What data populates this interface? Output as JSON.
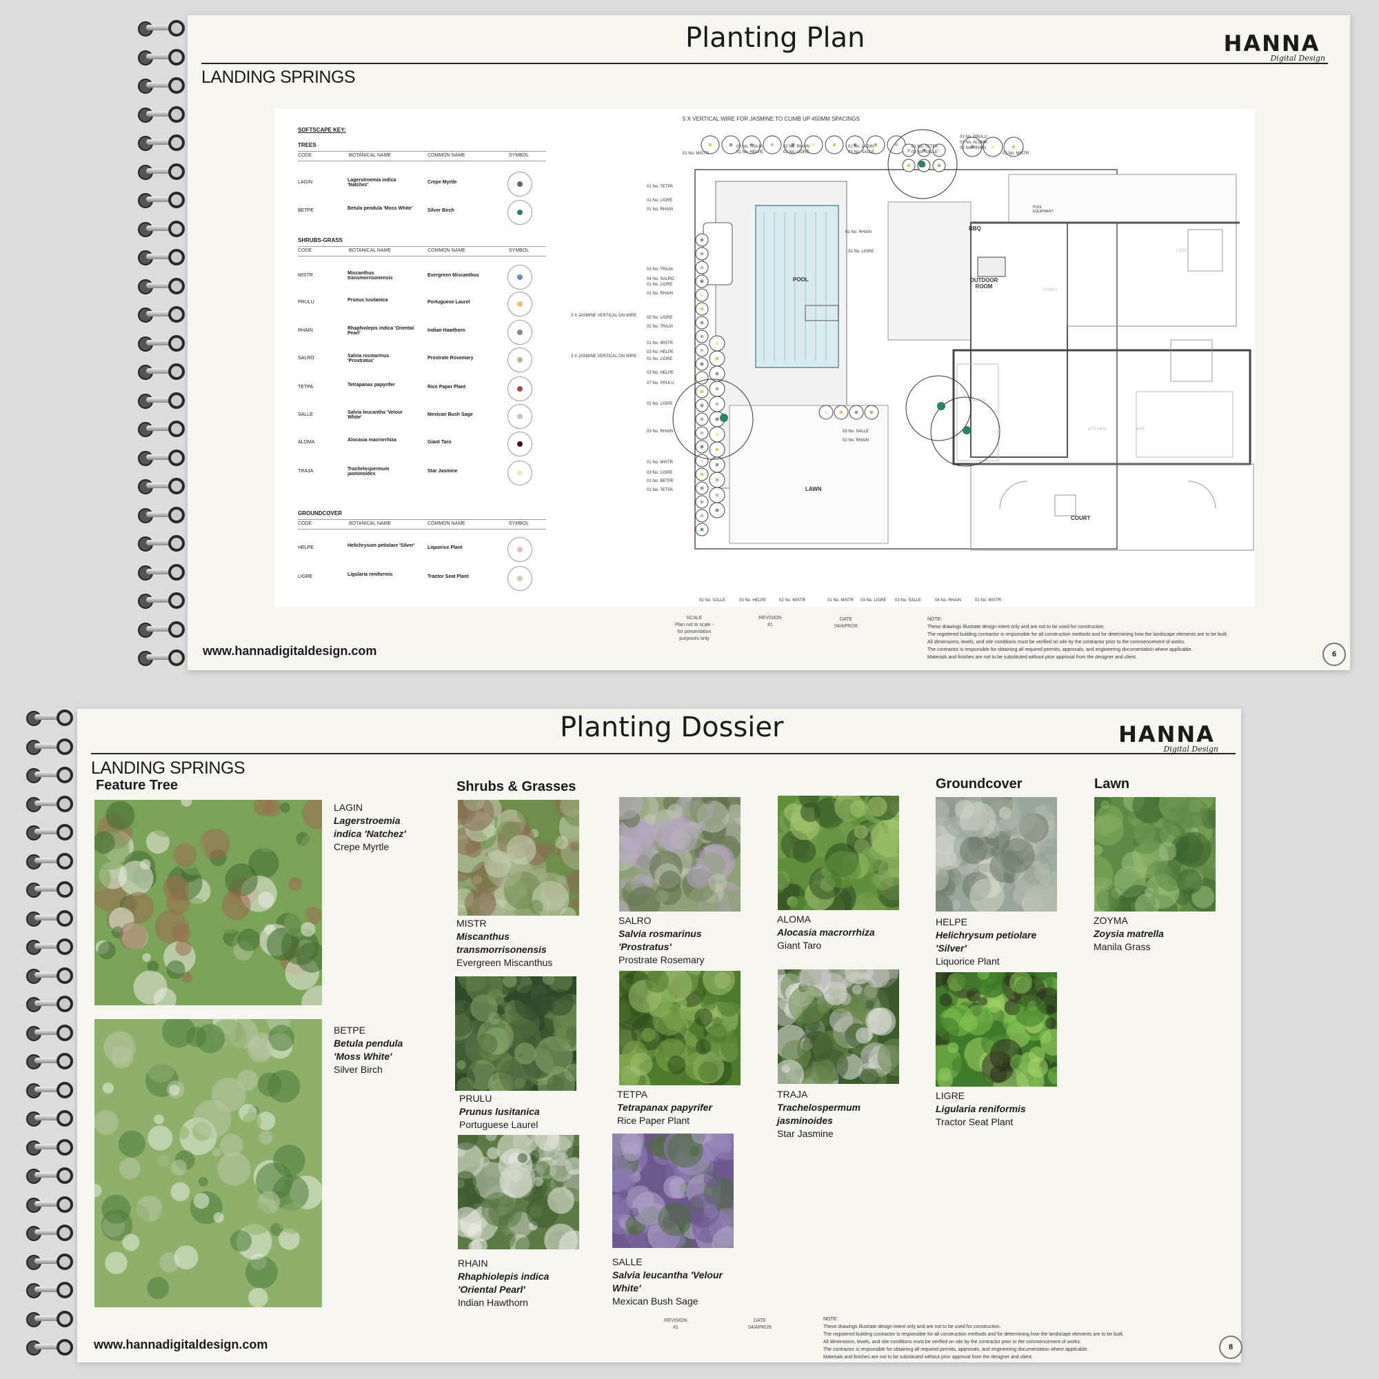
{
  "top_page": {
    "title": "Planting Plan",
    "logo": {
      "main": "HANNA",
      "sub": "Digital Design"
    },
    "project": "LANDING SPRINGS",
    "website": "www.hannadigitaldesign.com",
    "page_number": "6",
    "key": {
      "heading": "SOFTSCAPE KEY:",
      "columns": [
        "CODE",
        "BOTANICAL NAME",
        "COMMON NAME",
        "SYMBOL"
      ],
      "groups": [
        {
          "name": "TREES",
          "rows": [
            {
              "code": "LAGIN",
              "botanical": "Lagerstroemia indica 'Natchez'",
              "common": "Crepe Myrtle",
              "color": "#5e6b61"
            },
            {
              "code": "BETPE",
              "botanical": "Betula pendula 'Moss White'",
              "common": "Silver Birch",
              "color": "#2f7d6b"
            }
          ]
        },
        {
          "name": "SHRUBS-GRASS",
          "rows": [
            {
              "code": "MISTR",
              "botanical": "Miscanthus transmorrisonensis",
              "common": "Evergreen Miscanthus",
              "color": "#6b8fb8"
            },
            {
              "code": "PRULU",
              "botanical": "Prunus lusitanica",
              "common": "Portuguese Laurel",
              "color": "#e8c56a"
            },
            {
              "code": "RHAIN",
              "botanical": "Rhaphiolepis indica 'Oriental Pearl'",
              "common": "Indian Hawthorn",
              "color": "#8a8a8a"
            },
            {
              "code": "SALRO",
              "botanical": "Salvia rosmarinus 'Prostratus'",
              "common": "Prostrate Rosemary",
              "color": "#b4b68e"
            },
            {
              "code": "TETPA",
              "botanical": "Tetrapanax papyrifer",
              "common": "Rice Paper Plant",
              "color": "#a44a43"
            },
            {
              "code": "SALLE",
              "botanical": "Salvia leucantha 'Velour White'",
              "common": "Mexican Bush Sage",
              "color": "#c2c2c8"
            },
            {
              "code": "ALOMA",
              "botanical": "Alocasia macrorrhiza",
              "common": "Giant Taro",
              "color": "#3a1a22"
            },
            {
              "code": "TRAJA",
              "botanical": "Trachelospermum jasminoides",
              "common": "Star Jasmine",
              "color": "#f2e9b8"
            }
          ]
        },
        {
          "name": "GROUNDCOVER",
          "rows": [
            {
              "code": "HELPE",
              "botanical": "Helichrysum petiolare 'Silver'",
              "common": "Liquorice Plant",
              "color": "#e9b9c2"
            },
            {
              "code": "LIGRE",
              "botanical": "Ligularia reniformis",
              "common": "Tractor Seat Plant",
              "color": "#c9d1b5"
            }
          ]
        }
      ]
    },
    "plan": {
      "header_note": "5 X VERTICAL WIRE FOR JASMINE TO CLIMB UP 450MM SPACINGS",
      "areas": {
        "pool": "POOL",
        "outdoor_room": "OUTDOOR ROOM",
        "lawn": "LAWN",
        "court": "COURT",
        "bbq": "BBQ",
        "family": "FAMILY",
        "dining": "DINING",
        "kitchen": "KITCHEN",
        "laundry": "LNDY",
        "pool_equipment": "POOL EQUIPMENT",
        "wir": "WIR"
      },
      "side_notes": [
        "3 X JASMINE VERTICAL ON WIRE",
        "3 X JASMINE VERTICAL ON WIRE"
      ],
      "top_tags": [
        "01 No. MISTR",
        "03 No. TRAJA",
        "02 No. HELPE",
        "02 No. RHAIN",
        "02 No. LIGRE",
        "01 No. LAGIN",
        "03 No. SALLE",
        "01 No. TETPA",
        "03 No. SALLE",
        "03 No. PRULU",
        "01 No. ALOMA",
        "02 No. RHAIN",
        "03 No. MISTR"
      ],
      "left_tags": [
        "01 No. TETPA",
        "01 No. LIGRE",
        "01 No. RHAIN",
        "03 No. TRAJA",
        "04 No. SALRO",
        "01 No. LIGRE",
        "01 No. RHAIN",
        "02 No. LIGRE",
        "02 No. TRAJA",
        "01 No. MISTR",
        "03 No. HELPE",
        "01 No. LIGRE",
        "03 No. HELPE",
        "07 No. PRULU",
        "02 No. LIGRE",
        "03 No. RHAIN",
        "01 No. MISTR",
        "03 No. LIGRE",
        "01 No. BETPE",
        "01 No. TETPA"
      ],
      "bottom_tags": [
        "02 No. SALLE",
        "03 No. HELPE",
        "02 No. MISTR",
        "01 No. MISTR",
        "03 No. LIGRE",
        "03 No. SALLE",
        "04 No. RHAIN",
        "01 No. MISTR"
      ],
      "inner_tags": [
        "01 No. RHAIN",
        "02 No. LIGRE",
        "03 No. SALLE",
        "02 No. RHAIN"
      ]
    },
    "meta": {
      "scale_label": "SCALE",
      "scale_value": "Plan not to scale - for presentation purposes only",
      "revision_label": "REVISION",
      "revision_value": "#1",
      "date_label": "DATE",
      "date_value": "04/APR/26"
    },
    "note": [
      "NOTE:",
      "These drawings illustrate design intent only and are not to be used for construction.",
      "The registered building contractor is responsible for all construction methods and for determining how the landscape elements are to be built.",
      "All dimensions, levels, and site conditions must be verified on site by the contractor prior to the commencement of works.",
      "The contractor is responsible for obtaining all required permits, approvals, and engineering documentation where applicable.",
      "Materials and finishes are not to be substituted without prior approval from the designer and client."
    ]
  },
  "bottom_page": {
    "title": "Planting Dossier",
    "logo": {
      "main": "HANNA",
      "sub": "Digital Design"
    },
    "project": "LANDING SPRINGS",
    "website": "www.hannadigitaldesign.com",
    "page_number": "8",
    "sections": {
      "feature_tree": "Feature Tree",
      "shrubs": "Shrubs & Grasses",
      "groundcover": "Groundcover",
      "lawn": "Lawn"
    },
    "plants": [
      {
        "code": "LAGIN",
        "botanical": "Lagerstroemia indica 'Natchez'",
        "common": "Crepe Myrtle"
      },
      {
        "code": "BETPE",
        "botanical": "Betula pendula 'Moss White'",
        "common": "Silver Birch"
      },
      {
        "code": "MISTR",
        "botanical": "Miscanthus transmorrisonensis",
        "common": "Evergreen Miscanthus"
      },
      {
        "code": "SALRO",
        "botanical": "Salvia rosmarinus 'Prostratus'",
        "common": "Prostrate Rosemary"
      },
      {
        "code": "ALOMA",
        "botanical": "Alocasia macrorrhiza",
        "common": "Giant Taro"
      },
      {
        "code": "HELPE",
        "botanical": "Helichrysum petiolare 'Silver'",
        "common": "Liquorice Plant"
      },
      {
        "code": "ZOYMA",
        "botanical": "Zoysia matrella",
        "common": "Manila Grass"
      },
      {
        "code": "PRULU",
        "botanical": "Prunus lusitanica",
        "common": "Portuguese Laurel"
      },
      {
        "code": "TETPA",
        "botanical": "Tetrapanax papyrifer",
        "common": "Rice Paper Plant"
      },
      {
        "code": "TRAJA",
        "botanical": "Trachelospermum jasminoides",
        "common": "Star Jasmine"
      },
      {
        "code": "LIGRE",
        "botanical": "Ligularia reniformis",
        "common": "Tractor Seat Plant"
      },
      {
        "code": "RHAIN",
        "botanical": "Rhaphiolepis indica 'Oriental Pearl'",
        "common": "Indian Hawthorn"
      },
      {
        "code": "SALLE",
        "botanical": "Salvia leucantha 'Velour White'",
        "common": "Mexican Bush Sage"
      }
    ],
    "meta": {
      "revision_label": "REVISION",
      "revision_value": "#1",
      "date_label": "DATE",
      "date_value": "04/APR/26"
    },
    "note": [
      "NOTE:",
      "These drawings illustrate design intent only and are not to be used for construction.",
      "The registered building contractor is responsible for all construction methods and for determining how the landscape elements are to be built.",
      "All dimensions, levels, and site conditions must be verified on site by the contractor prior to the commencement of works.",
      "The contractor is responsible for obtaining all required permits, approvals, and engineering documentation where applicable.",
      "Materials and finishes are not to be substituted without prior approval from the designer and client."
    ]
  }
}
